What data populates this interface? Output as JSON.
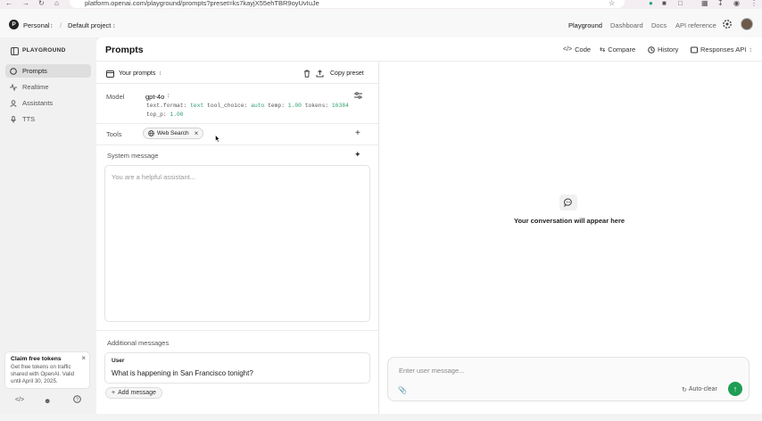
{
  "browser": {
    "url": "platform.openai.com/playground/prompts?preset=ks7kayjX55ehTBR9oyUvIuJe",
    "icons": [
      "back-icon",
      "forward-icon",
      "reload-icon",
      "home-icon",
      "star-icon",
      "extensions-icon",
      "download-icon",
      "profile-icon",
      "menu-icon"
    ]
  },
  "topnav": {
    "org_initial": "P",
    "org_name": "Personal",
    "separator": "/",
    "project": "Default project",
    "links": [
      "Playground",
      "Dashboard",
      "Docs",
      "API reference"
    ]
  },
  "sidebar": {
    "section": "PLAYGROUND",
    "items": [
      {
        "label": "Prompts",
        "icon": "chat-icon",
        "active": true
      },
      {
        "label": "Realtime",
        "icon": "realtime-icon",
        "active": false
      },
      {
        "label": "Assistants",
        "icon": "assistants-icon",
        "active": false
      },
      {
        "label": "TTS",
        "icon": "mic-icon",
        "active": false
      }
    ],
    "promo": {
      "title": "Claim free tokens",
      "body": "Get free tokens on traffic shared with OpenAI. Valid until April 30, 2025."
    },
    "footer_icons": [
      "code-icon",
      "users-icon",
      "help-icon"
    ]
  },
  "main": {
    "title": "Prompts",
    "header_actions": [
      {
        "label": "Code",
        "icon": "code-icon"
      },
      {
        "label": "Compare",
        "icon": "compare-icon"
      },
      {
        "label": "History",
        "icon": "history-icon"
      },
      {
        "label": "Responses API",
        "icon": "api-icon"
      }
    ],
    "your_prompts": "Your prompts",
    "copy_preset": "Copy preset",
    "model_label": "Model",
    "model": "gpt-4o",
    "params": {
      "k1": "text.format:",
      "v1": "text",
      "k2": "tool_choice:",
      "v2": "auto",
      "k3": "temp:",
      "v3": "1.00",
      "k4": "tokens:",
      "v4": "16384",
      "k5": "top_p:",
      "v5": "1.00"
    },
    "tools_label": "Tools",
    "tool_chip": "Web Search",
    "system_label": "System message",
    "system_placeholder": "You are a helpful assistant...",
    "additional_label": "Additional messages",
    "message_role": "User",
    "message_text": "What is happening in San Francisco tonight?",
    "add_message": "Add message"
  },
  "chat": {
    "empty_text": "Your conversation will appear here",
    "input_placeholder": "Enter user message...",
    "auto_clear": "Auto-clear"
  },
  "colors": {
    "accent_green": "#1f9d55",
    "param_green": "#2f9e6d"
  }
}
